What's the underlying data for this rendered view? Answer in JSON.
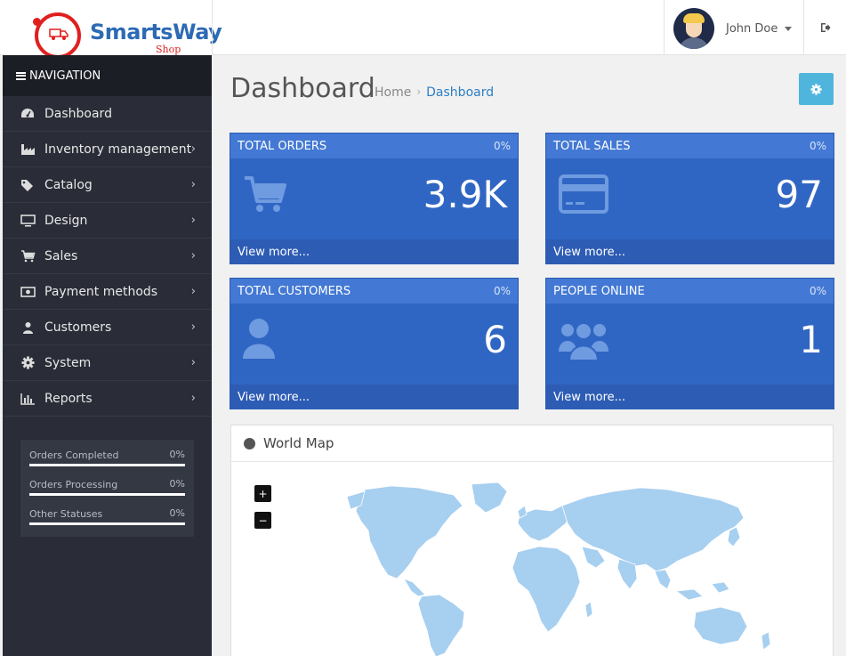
{
  "logo": {
    "name": "SmartsWay",
    "sub": "Shop"
  },
  "user": {
    "name": "John Doe"
  },
  "nav": {
    "title": "NAVIGATION",
    "items": [
      {
        "label": "Dashboard",
        "icon": "dashboard-icon",
        "has_children": false
      },
      {
        "label": "Inventory management",
        "icon": "factory-icon",
        "has_children": true
      },
      {
        "label": "Catalog",
        "icon": "tags-icon",
        "has_children": true
      },
      {
        "label": "Design",
        "icon": "desktop-icon",
        "has_children": true
      },
      {
        "label": "Sales",
        "icon": "cart-icon",
        "has_children": true
      },
      {
        "label": "Payment methods",
        "icon": "money-icon",
        "has_children": true
      },
      {
        "label": "Customers",
        "icon": "user-icon",
        "has_children": true
      },
      {
        "label": "System",
        "icon": "gear-icon",
        "has_children": true
      },
      {
        "label": "Reports",
        "icon": "bar-chart-icon",
        "has_children": true
      }
    ],
    "status": [
      {
        "label": "Orders Completed",
        "percent": "0%",
        "value": 0
      },
      {
        "label": "Orders Processing",
        "percent": "0%",
        "value": 0
      },
      {
        "label": "Other Statuses",
        "percent": "0%",
        "value": 0
      }
    ]
  },
  "page": {
    "title": "Dashboard",
    "breadcrumb": {
      "home": "Home",
      "current": "Dashboard"
    }
  },
  "tiles": [
    {
      "title": "TOTAL ORDERS",
      "percent": "0%",
      "value": "3.9K",
      "footer": "View more...",
      "icon": "cart-icon"
    },
    {
      "title": "TOTAL SALES",
      "percent": "0%",
      "value": "97",
      "footer": "View more...",
      "icon": "credit-card-icon"
    },
    {
      "title": "TOTAL CUSTOMERS",
      "percent": "0%",
      "value": "6",
      "footer": "View more...",
      "icon": "user-icon"
    },
    {
      "title": "PEOPLE ONLINE",
      "percent": "0%",
      "value": "1",
      "footer": "View more...",
      "icon": "users-icon"
    }
  ],
  "map": {
    "title": "World Map",
    "zoom_in": "+",
    "zoom_out": "−"
  },
  "colors": {
    "accent": "#3066c3",
    "sidebar": "#2a2d37",
    "settings": "#4fb5dd",
    "map_land": "#a7cff0"
  }
}
